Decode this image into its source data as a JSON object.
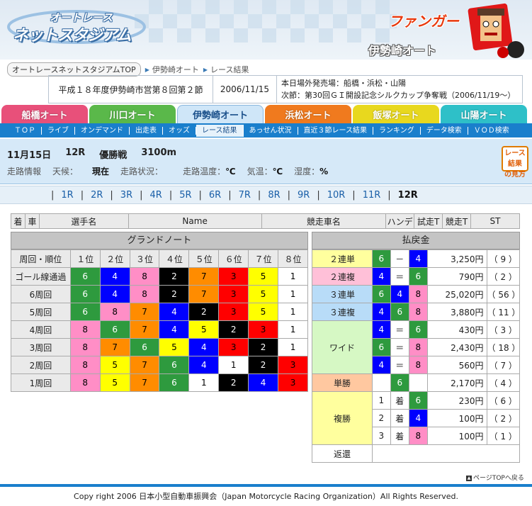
{
  "header": {
    "logo_top": "オートレース",
    "logo_bottom": "ネットスタジアム",
    "brand": "ファンガー",
    "venue_title": "伊勢崎オート"
  },
  "breadcrumb": {
    "home": "オートレースネットスタジアムTOP",
    "items": [
      "伊勢崎オート",
      "レース結果"
    ]
  },
  "info": {
    "meet": "平成１８年度伊勢崎市営第８回第２節",
    "date": "2006/11/15",
    "line1": "本日場外発売場：船橋・浜松・山陽",
    "line2": "次節：第30回ＧＩ開設記念シルクカップ争奪戦（2006/11/19～）"
  },
  "venues": [
    {
      "label": "船橋オート",
      "color": "#e8507a"
    },
    {
      "label": "川口オート",
      "color": "#5ab84a"
    },
    {
      "label": "伊勢崎オート",
      "color": "#cfe6f8"
    },
    {
      "label": "浜松オート",
      "color": "#f07a1e"
    },
    {
      "label": "飯塚オート",
      "color": "#e8d81e"
    },
    {
      "label": "山陽オート",
      "color": "#2ec0c8"
    }
  ],
  "subnav": [
    "ＴＯＰ",
    "ライブ",
    "オンデマンド",
    "出走表",
    "オッズ",
    "レース結果",
    "あっせん状況",
    "直近３節レース結果",
    "ランキング",
    "データ検索",
    "ＶＯＤ検索"
  ],
  "race": {
    "date": "11月15日",
    "number": "12R",
    "name": "優勝戦",
    "distance": "3100m",
    "track_info": "走路情報",
    "weather_label": "天候：",
    "weather": "現在",
    "track_state_label": "走路状況：",
    "track_temp_label": "走路温度：",
    "track_temp_unit": "℃",
    "air_temp_label": "気温：",
    "air_temp_unit": "℃",
    "humidity_label": "湿度：",
    "humidity_unit": "%",
    "howto_l1": "レース結果",
    "howto_l2": "の見方"
  },
  "race_nav": [
    "1R",
    "2R",
    "3R",
    "4R",
    "5R",
    "6R",
    "7R",
    "8R",
    "9R",
    "10R",
    "11R",
    "12R"
  ],
  "result_header": [
    "着",
    "車",
    "選手名",
    "Name",
    "競走車名",
    "ハンデ",
    "試走T",
    "競走T",
    "ST"
  ],
  "grand_note": {
    "title": "グランドノート",
    "col_label": "周回・順位",
    "positions": [
      "１位",
      "２位",
      "３位",
      "４位",
      "５位",
      "６位",
      "７位",
      "８位"
    ],
    "rows": [
      {
        "label": "ゴール線通過",
        "cars": [
          "6",
          "4",
          "8",
          "2",
          "7",
          "3",
          "5",
          "1"
        ]
      },
      {
        "label": "6周回",
        "cars": [
          "6",
          "4",
          "8",
          "2",
          "7",
          "3",
          "5",
          "1"
        ]
      },
      {
        "label": "5周回",
        "cars": [
          "6",
          "8",
          "7",
          "4",
          "2",
          "3",
          "5",
          "1"
        ]
      },
      {
        "label": "4周回",
        "cars": [
          "8",
          "6",
          "7",
          "4",
          "5",
          "2",
          "3",
          "1"
        ]
      },
      {
        "label": "3周回",
        "cars": [
          "8",
          "7",
          "6",
          "5",
          "4",
          "3",
          "2",
          "1"
        ]
      },
      {
        "label": "2周回",
        "cars": [
          "8",
          "5",
          "7",
          "6",
          "4",
          "1",
          "2",
          "3"
        ]
      },
      {
        "label": "1周回",
        "cars": [
          "8",
          "5",
          "7",
          "6",
          "1",
          "2",
          "4",
          "3"
        ]
      }
    ]
  },
  "car_colors": {
    "1": {
      "bg": "#ffffff",
      "fg": "#000000"
    },
    "2": {
      "bg": "#000000",
      "fg": "#ffffff"
    },
    "3": {
      "bg": "#ff0000",
      "fg": "#000000"
    },
    "4": {
      "bg": "#0000ff",
      "fg": "#ffffff"
    },
    "5": {
      "bg": "#ffff00",
      "fg": "#000000"
    },
    "6": {
      "bg": "#2e9a3e",
      "fg": "#ffffff"
    },
    "7": {
      "bg": "#ff8c00",
      "fg": "#000000"
    },
    "8": {
      "bg": "#ff8ec6",
      "fg": "#000000"
    }
  },
  "payout": {
    "title": "払戻金",
    "rows": [
      {
        "type": "２連単",
        "bg": "#ffff9e",
        "c1": "6",
        "sep": "－",
        "c2": "4",
        "amount": "3,250円",
        "pop": "（ 9 ）"
      },
      {
        "type": "２連複",
        "bg": "#ffc0d8",
        "c1": "4",
        "sep": "＝",
        "c2": "6",
        "amount": "790円",
        "pop": "（ 2 ）"
      },
      {
        "type": "３連単",
        "bg": "#b8dcf8",
        "c1": "6",
        "c2": "4",
        "c3": "8",
        "amount": "25,020円",
        "pop": "（ 56 ）"
      },
      {
        "type": "３連複",
        "bg": "#b8dcf8",
        "c1": "4",
        "c2": "6",
        "c3": "8",
        "amount": "3,880円",
        "pop": "（ 11 ）"
      },
      {
        "type": "ワイド",
        "bg": "#d6f8c4",
        "pairs": [
          {
            "c1": "4",
            "sep": "＝",
            "c2": "6",
            "amount": "430円",
            "pop": "（ 3 ）"
          },
          {
            "c1": "6",
            "sep": "＝",
            "c2": "8",
            "amount": "2,430円",
            "pop": "（ 18 ）"
          },
          {
            "c1": "4",
            "sep": "＝",
            "c2": "8",
            "amount": "560円",
            "pop": "（ 7 ）"
          }
        ]
      },
      {
        "type": "単勝",
        "bg": "#ffc8a0",
        "c1": "6",
        "amount": "2,170円",
        "pop": "（ 4 ）"
      },
      {
        "type": "複勝",
        "bg": "#ffff9e",
        "places": [
          {
            "rank": "1",
            "sep": "着",
            "c": "6",
            "amount": "230円",
            "pop": "（ 6 ）"
          },
          {
            "rank": "2",
            "sep": "着",
            "c": "4",
            "amount": "100円",
            "pop": "（ 2 ）"
          },
          {
            "rank": "3",
            "sep": "着",
            "c": "8",
            "amount": "100円",
            "pop": "（ 1 ）"
          }
        ]
      },
      {
        "type": "返還",
        "bg": "#ffffff"
      }
    ]
  },
  "footer": {
    "page_top": "ページTOPへ戻る",
    "copyright": "Copy right 2006 日本小型自動車振興会（Japan Motorcycle Racing Organization）All Rights Reserved."
  }
}
